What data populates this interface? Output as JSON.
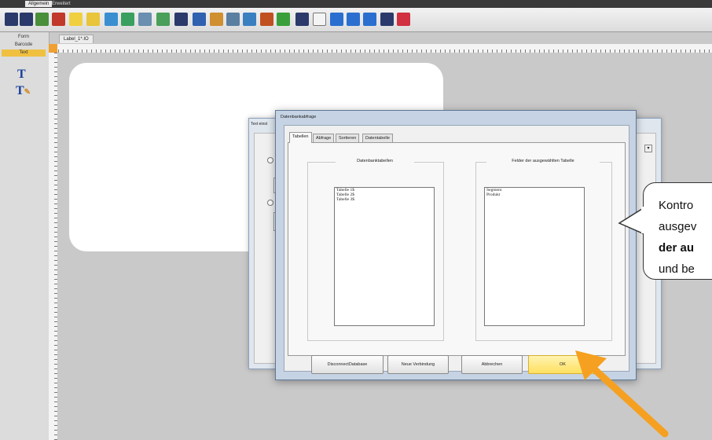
{
  "tabstrip": {
    "tabs": [
      "Allgemein",
      "Erweitert"
    ]
  },
  "left_panel": {
    "items": [
      "Form",
      "Barcode",
      "Text"
    ],
    "selected": "Text",
    "icons": [
      "text-tool-icon",
      "rich-text-tool-icon"
    ]
  },
  "document": {
    "tab_label": "Label_1*.IO"
  },
  "back_dialog": {
    "title": "Text einst"
  },
  "dialog": {
    "title": "Datenbankabfrage",
    "tabs": [
      "Tabellen",
      "Abfrage",
      "Sortieren",
      "Datentabelle"
    ],
    "active_tab": "Tabellen",
    "left_group": {
      "label": "Datenbanktabellen",
      "items": [
        "Tabelle 1$",
        "Tabelle 2$",
        "Tabelle 3$"
      ]
    },
    "right_group": {
      "label": "Felder der ausgewählten Tabelle",
      "items": [
        "Segment",
        "Produkt"
      ]
    },
    "buttons": {
      "disconnect": "DisconnectDatabase",
      "new_connection": "Neue Verbindung",
      "cancel": "Abbrechen",
      "ok": "OK"
    }
  },
  "callout": {
    "line1": "Kontro",
    "line2": "ausgev",
    "line3": "der au",
    "line4": "und be"
  },
  "colors": {
    "ok_button": "#ffe060",
    "arrow": "#f5a020",
    "selected_panel": "#f0c040"
  }
}
